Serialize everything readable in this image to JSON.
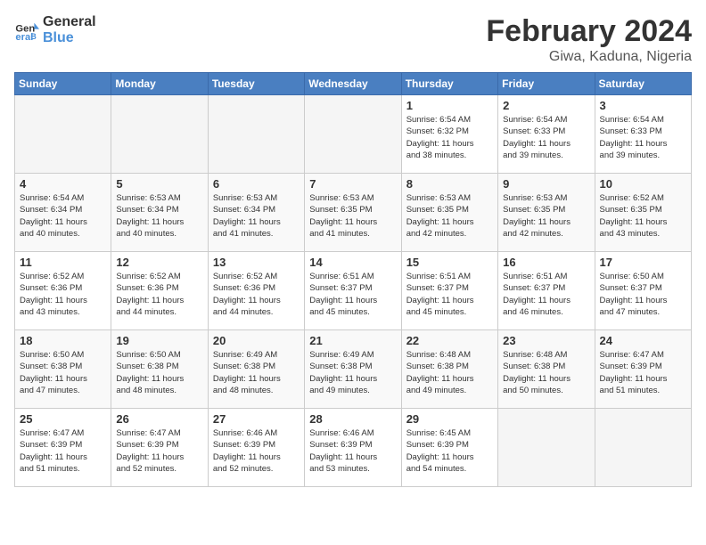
{
  "logo": {
    "line1": "General",
    "line2": "Blue"
  },
  "title": "February 2024",
  "subtitle": "Giwa, Kaduna, Nigeria",
  "headers": [
    "Sunday",
    "Monday",
    "Tuesday",
    "Wednesday",
    "Thursday",
    "Friday",
    "Saturday"
  ],
  "weeks": [
    [
      {
        "day": "",
        "detail": ""
      },
      {
        "day": "",
        "detail": ""
      },
      {
        "day": "",
        "detail": ""
      },
      {
        "day": "",
        "detail": ""
      },
      {
        "day": "1",
        "detail": "Sunrise: 6:54 AM\nSunset: 6:32 PM\nDaylight: 11 hours\nand 38 minutes."
      },
      {
        "day": "2",
        "detail": "Sunrise: 6:54 AM\nSunset: 6:33 PM\nDaylight: 11 hours\nand 39 minutes."
      },
      {
        "day": "3",
        "detail": "Sunrise: 6:54 AM\nSunset: 6:33 PM\nDaylight: 11 hours\nand 39 minutes."
      }
    ],
    [
      {
        "day": "4",
        "detail": "Sunrise: 6:54 AM\nSunset: 6:34 PM\nDaylight: 11 hours\nand 40 minutes."
      },
      {
        "day": "5",
        "detail": "Sunrise: 6:53 AM\nSunset: 6:34 PM\nDaylight: 11 hours\nand 40 minutes."
      },
      {
        "day": "6",
        "detail": "Sunrise: 6:53 AM\nSunset: 6:34 PM\nDaylight: 11 hours\nand 41 minutes."
      },
      {
        "day": "7",
        "detail": "Sunrise: 6:53 AM\nSunset: 6:35 PM\nDaylight: 11 hours\nand 41 minutes."
      },
      {
        "day": "8",
        "detail": "Sunrise: 6:53 AM\nSunset: 6:35 PM\nDaylight: 11 hours\nand 42 minutes."
      },
      {
        "day": "9",
        "detail": "Sunrise: 6:53 AM\nSunset: 6:35 PM\nDaylight: 11 hours\nand 42 minutes."
      },
      {
        "day": "10",
        "detail": "Sunrise: 6:52 AM\nSunset: 6:35 PM\nDaylight: 11 hours\nand 43 minutes."
      }
    ],
    [
      {
        "day": "11",
        "detail": "Sunrise: 6:52 AM\nSunset: 6:36 PM\nDaylight: 11 hours\nand 43 minutes."
      },
      {
        "day": "12",
        "detail": "Sunrise: 6:52 AM\nSunset: 6:36 PM\nDaylight: 11 hours\nand 44 minutes."
      },
      {
        "day": "13",
        "detail": "Sunrise: 6:52 AM\nSunset: 6:36 PM\nDaylight: 11 hours\nand 44 minutes."
      },
      {
        "day": "14",
        "detail": "Sunrise: 6:51 AM\nSunset: 6:37 PM\nDaylight: 11 hours\nand 45 minutes."
      },
      {
        "day": "15",
        "detail": "Sunrise: 6:51 AM\nSunset: 6:37 PM\nDaylight: 11 hours\nand 45 minutes."
      },
      {
        "day": "16",
        "detail": "Sunrise: 6:51 AM\nSunset: 6:37 PM\nDaylight: 11 hours\nand 46 minutes."
      },
      {
        "day": "17",
        "detail": "Sunrise: 6:50 AM\nSunset: 6:37 PM\nDaylight: 11 hours\nand 47 minutes."
      }
    ],
    [
      {
        "day": "18",
        "detail": "Sunrise: 6:50 AM\nSunset: 6:38 PM\nDaylight: 11 hours\nand 47 minutes."
      },
      {
        "day": "19",
        "detail": "Sunrise: 6:50 AM\nSunset: 6:38 PM\nDaylight: 11 hours\nand 48 minutes."
      },
      {
        "day": "20",
        "detail": "Sunrise: 6:49 AM\nSunset: 6:38 PM\nDaylight: 11 hours\nand 48 minutes."
      },
      {
        "day": "21",
        "detail": "Sunrise: 6:49 AM\nSunset: 6:38 PM\nDaylight: 11 hours\nand 49 minutes."
      },
      {
        "day": "22",
        "detail": "Sunrise: 6:48 AM\nSunset: 6:38 PM\nDaylight: 11 hours\nand 49 minutes."
      },
      {
        "day": "23",
        "detail": "Sunrise: 6:48 AM\nSunset: 6:38 PM\nDaylight: 11 hours\nand 50 minutes."
      },
      {
        "day": "24",
        "detail": "Sunrise: 6:47 AM\nSunset: 6:39 PM\nDaylight: 11 hours\nand 51 minutes."
      }
    ],
    [
      {
        "day": "25",
        "detail": "Sunrise: 6:47 AM\nSunset: 6:39 PM\nDaylight: 11 hours\nand 51 minutes."
      },
      {
        "day": "26",
        "detail": "Sunrise: 6:47 AM\nSunset: 6:39 PM\nDaylight: 11 hours\nand 52 minutes."
      },
      {
        "day": "27",
        "detail": "Sunrise: 6:46 AM\nSunset: 6:39 PM\nDaylight: 11 hours\nand 52 minutes."
      },
      {
        "day": "28",
        "detail": "Sunrise: 6:46 AM\nSunset: 6:39 PM\nDaylight: 11 hours\nand 53 minutes."
      },
      {
        "day": "29",
        "detail": "Sunrise: 6:45 AM\nSunset: 6:39 PM\nDaylight: 11 hours\nand 54 minutes."
      },
      {
        "day": "",
        "detail": ""
      },
      {
        "day": "",
        "detail": ""
      }
    ]
  ]
}
